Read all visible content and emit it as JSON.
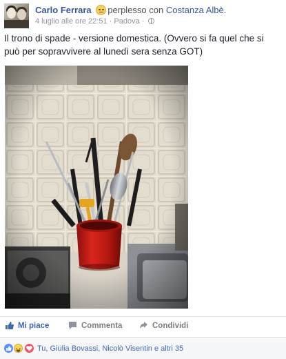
{
  "post": {
    "author": "Carlo Ferrara",
    "feeling_text": "perplesso",
    "with_word": "con",
    "tagged_person": "Costanza Albè.",
    "timestamp": "4 luglio alle ore 22:51",
    "separator": "·",
    "location": "Padova",
    "separator2": "·",
    "privacy_icon": "globe-icon",
    "text": "Il trono di spade - versione domestica. (Ovvero si fa quel che si può per sopravvivere al lunedì sera senza GOT)"
  },
  "actions": {
    "like_label": "Mi piace",
    "comment_label": "Commenta",
    "share_label": "Condividi"
  },
  "reactions": {
    "icons": [
      "like-icon",
      "haha-icon",
      "love-icon"
    ],
    "summary": "Tu, Giulia Bovassi, Nicolò Visentin e altri 35"
  },
  "colors": {
    "link": "#365899",
    "like_active": "#4267b2",
    "muted": "#90949c"
  }
}
